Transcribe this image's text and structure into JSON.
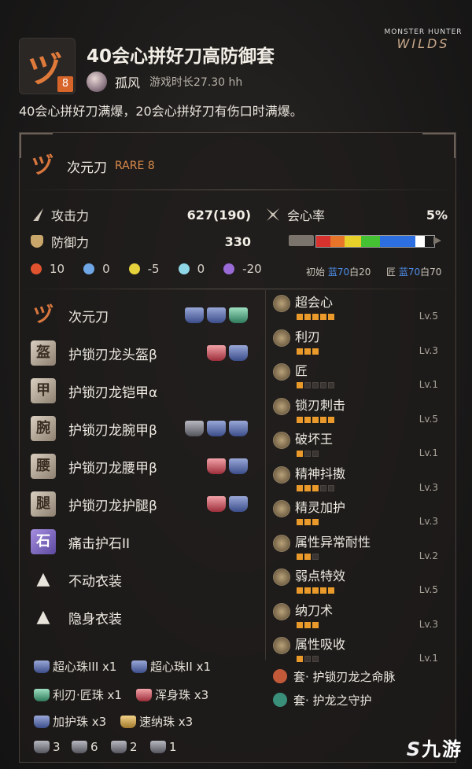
{
  "header": {
    "rare_badge": "8",
    "weapon_glyph": "ヅ",
    "title": "40会心拼好刀高防御套",
    "author": "孤风",
    "playtime": "游戏时长27.30 hh",
    "logo_line1": "MONSTER HUNTER",
    "logo_line2": "WILDS"
  },
  "description": "40会心拼好刀满爆，20会心拼好刀有伤口时满爆。",
  "weapon": {
    "name": "次元刀",
    "rare": "RARE 8"
  },
  "stats": {
    "attack_label": "攻击力",
    "attack_value": "627(190)",
    "affinity_label": "会心率",
    "affinity_value": "5%",
    "defense_label": "防御力",
    "defense_value": "330",
    "sharpness_initial": "初始",
    "sharpness_initial_blue": "蓝70",
    "sharpness_initial_white": "白20",
    "sharpness_max": "匠",
    "sharpness_max_blue": "蓝70",
    "sharpness_max_white": "白70",
    "sharpness_segments": [
      {
        "color": "#d8322e",
        "frac": 0.12
      },
      {
        "color": "#e8742a",
        "frac": 0.12
      },
      {
        "color": "#e8d02a",
        "frac": 0.14
      },
      {
        "color": "#44c234",
        "frac": 0.16
      },
      {
        "color": "#2d6fe0",
        "frac": 0.3
      },
      {
        "color": "#ffffff",
        "frac": 0.08
      },
      {
        "color": "#1a1a1a",
        "frac": 0.08
      }
    ]
  },
  "elements": [
    {
      "name": "fire",
      "value": "10",
      "color": "#e0532e"
    },
    {
      "name": "water",
      "value": "0",
      "color": "#6ea6e6"
    },
    {
      "name": "thunder",
      "value": "-5",
      "color": "#e6d23a"
    },
    {
      "name": "ice",
      "value": "0",
      "color": "#8fd6e6"
    },
    {
      "name": "dragon",
      "value": "-20",
      "color": "#9a6ad6"
    }
  ],
  "equipment": [
    {
      "name": "次元刀",
      "icon": "ヅ",
      "kind": "weapon",
      "slots": [
        "blue",
        "blue",
        "green"
      ]
    },
    {
      "name": "护锁刃龙头盔β",
      "icon": "盔",
      "kind": "armor",
      "slots": [
        "red",
        "blue"
      ]
    },
    {
      "name": "护锁刃龙铠甲α",
      "icon": "甲",
      "kind": "armor",
      "slots": []
    },
    {
      "name": "护锁刃龙腕甲β",
      "icon": "腕",
      "kind": "armor",
      "slots": [
        "grey",
        "blue",
        "blue"
      ]
    },
    {
      "name": "护锁刃龙腰甲β",
      "icon": "腰",
      "kind": "armor",
      "slots": [
        "red",
        "blue"
      ]
    },
    {
      "name": "护锁刃龙护腿β",
      "icon": "腿",
      "kind": "armor",
      "slots": [
        "red",
        "blue"
      ]
    },
    {
      "name": "痛击护石II",
      "icon": "石",
      "kind": "charm",
      "slots": []
    },
    {
      "name": "不动衣装",
      "icon": "▲",
      "kind": "outfit",
      "slots": []
    },
    {
      "name": "隐身衣装",
      "icon": "▲",
      "kind": "outfit",
      "slots": []
    }
  ],
  "skills": [
    {
      "name": "超会心",
      "on": 5,
      "total": 5,
      "lv": "Lv.5"
    },
    {
      "name": "利刃",
      "on": 3,
      "total": 3,
      "lv": "Lv.3"
    },
    {
      "name": "匠",
      "on": 1,
      "total": 5,
      "lv": "Lv.1"
    },
    {
      "name": "锁刃刺击",
      "on": 5,
      "total": 5,
      "lv": "Lv.5"
    },
    {
      "name": "破坏王",
      "on": 1,
      "total": 3,
      "lv": "Lv.1"
    },
    {
      "name": "精神抖擞",
      "on": 3,
      "total": 5,
      "lv": "Lv.3"
    },
    {
      "name": "精灵加护",
      "on": 3,
      "total": 3,
      "lv": "Lv.3"
    },
    {
      "name": "属性异常耐性",
      "on": 2,
      "total": 3,
      "lv": "Lv.2"
    },
    {
      "name": "弱点特效",
      "on": 5,
      "total": 5,
      "lv": "Lv.5"
    },
    {
      "name": "纳刀术",
      "on": 3,
      "total": 3,
      "lv": "Lv.3"
    },
    {
      "name": "属性吸收",
      "on": 1,
      "total": 3,
      "lv": "Lv.1"
    }
  ],
  "set_bonuses": [
    {
      "name": "套· 护锁刃龙之命脉",
      "color": "#c25a3a"
    },
    {
      "name": "套· 护龙之守护",
      "color": "#3a8f7a"
    }
  ],
  "decorations": [
    {
      "name": "超心珠III x1",
      "color": "blue"
    },
    {
      "name": "超心珠II x1",
      "color": "blue"
    },
    {
      "name": "利刃·匠珠 x1",
      "color": "green"
    },
    {
      "name": "浑身珠 x3",
      "color": "red"
    },
    {
      "name": "加护珠 x3",
      "color": "blue"
    },
    {
      "name": "速纳珠 x3",
      "color": "gold"
    }
  ],
  "slot_counts": [
    "3",
    "6",
    "2",
    "1"
  ],
  "watermark": "九游"
}
